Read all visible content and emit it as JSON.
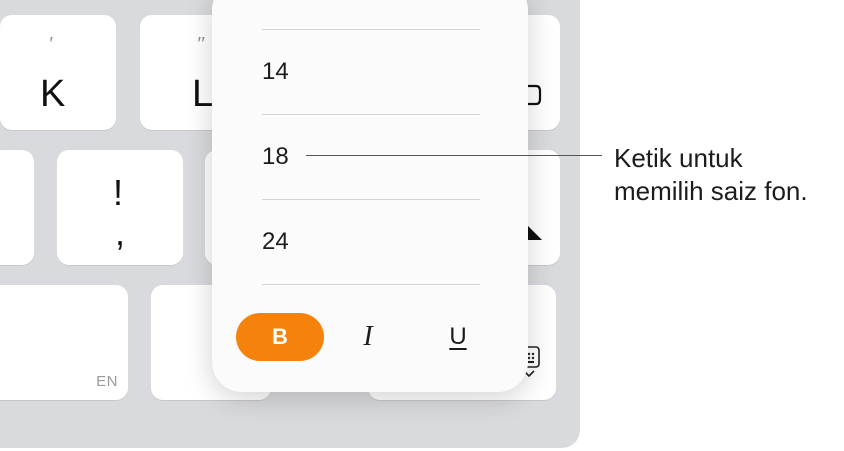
{
  "keyboard": {
    "keys": {
      "k": {
        "main": "K",
        "sub": "'"
      },
      "l": {
        "main": "L",
        "sub": "\""
      },
      "exclaim": {
        "main": "!",
        "sub": ","
      },
      "space_label": "EN"
    }
  },
  "font_size_popup": {
    "sizes": [
      "14",
      "18",
      "24"
    ],
    "style_buttons": {
      "bold": "B",
      "italic": "I",
      "underline": "U"
    },
    "accent_color": "#f5820b"
  },
  "callout": {
    "line1": "Ketik untuk",
    "line2": "memilih saiz fon."
  }
}
